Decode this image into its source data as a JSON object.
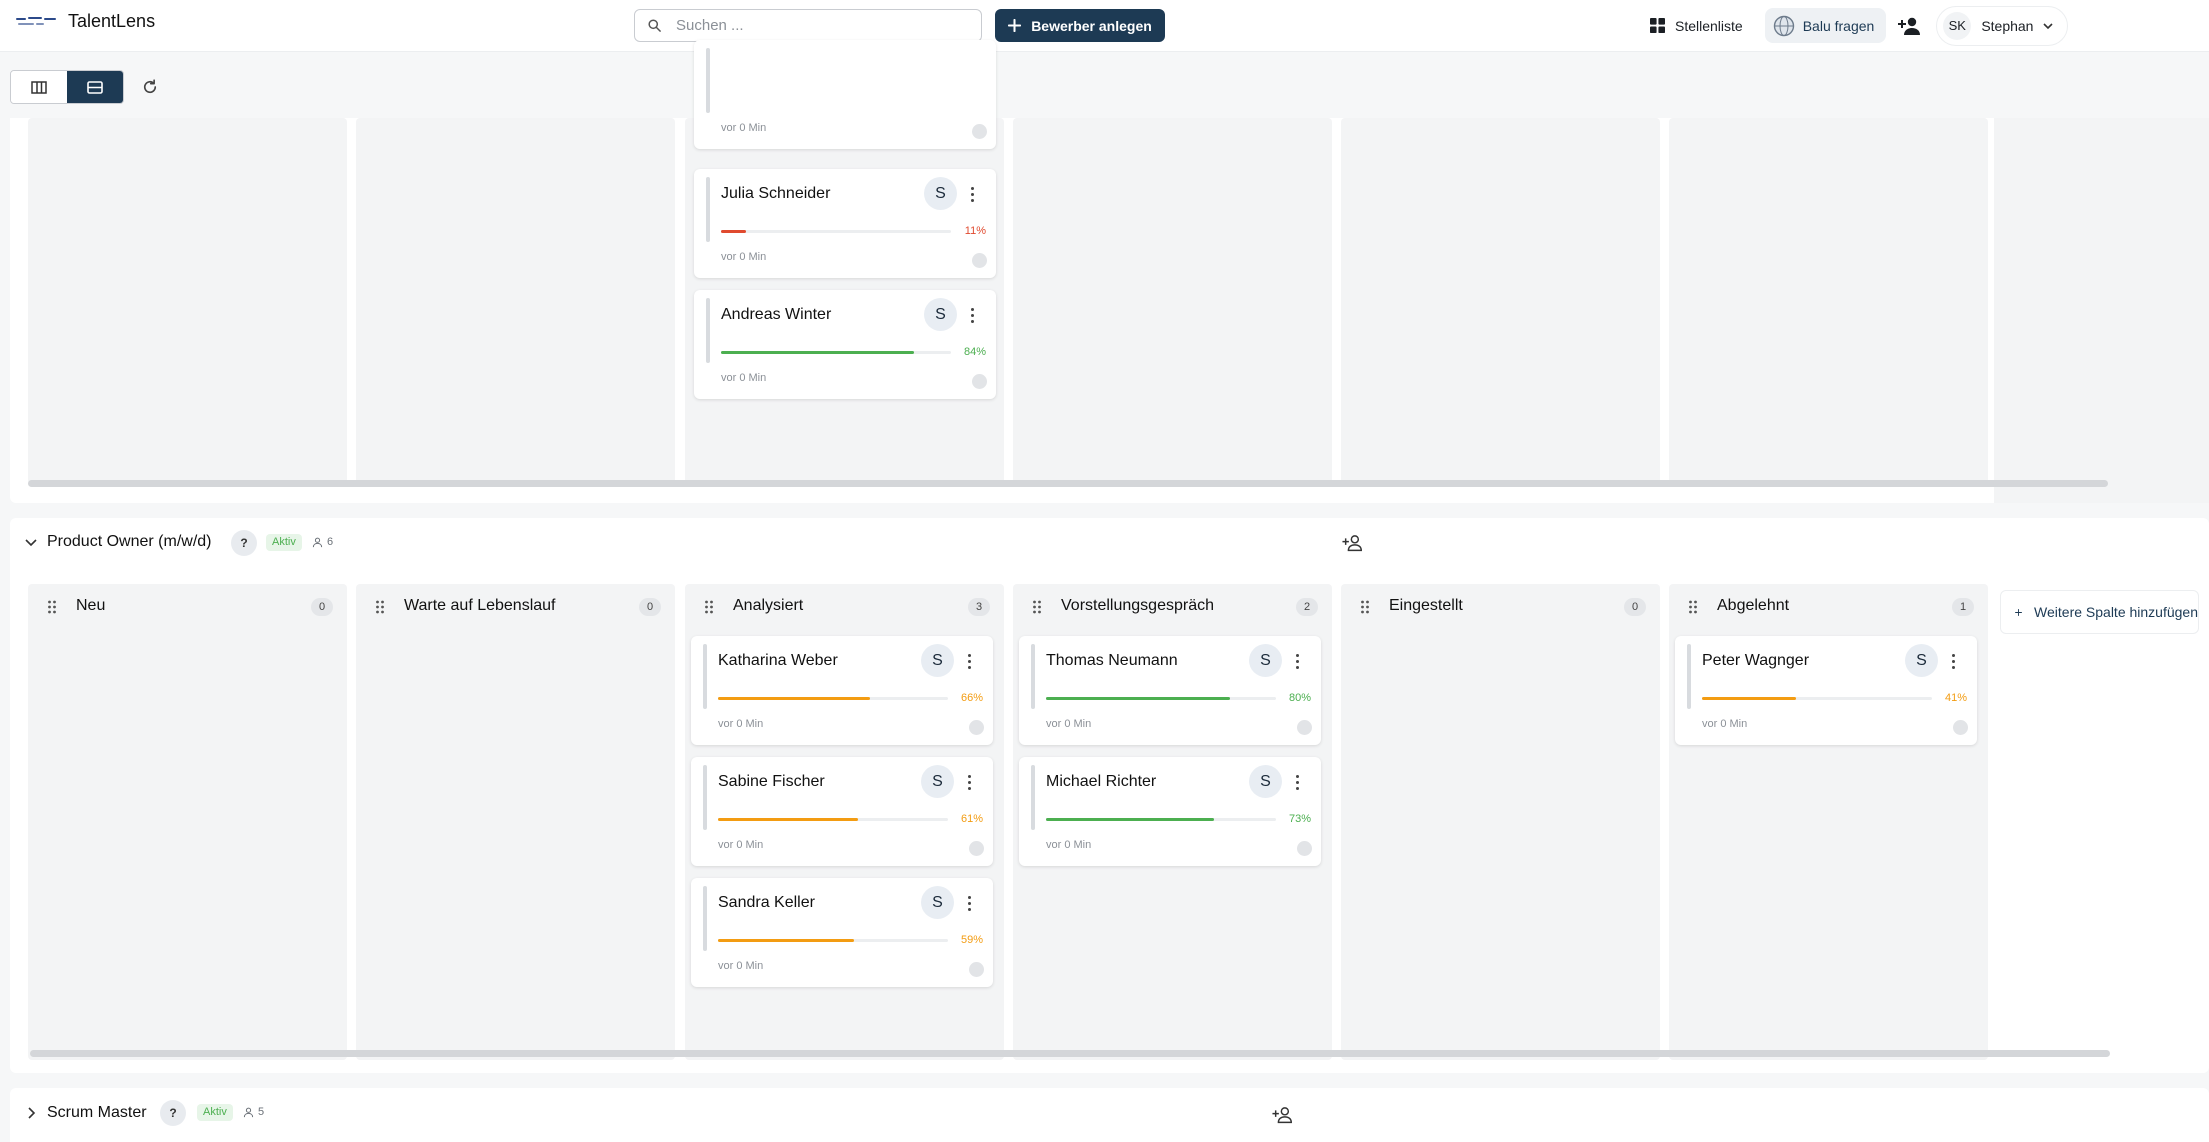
{
  "app": {
    "name": "TalentLens"
  },
  "search": {
    "placeholder": "Suchen ..."
  },
  "topbar": {
    "create_label": "Bewerber anlegen",
    "stellenliste_label": "Stellenliste",
    "balu_label": "Balu fragen",
    "user_initials": "SK",
    "user_name": "Stephan"
  },
  "boards": [
    {
      "id": "top",
      "columns": [
        {
          "cards": []
        },
        {
          "cards": []
        },
        {
          "cards": [
            {
              "name": "",
              "score": null,
              "time": "vor 0 Min"
            },
            {
              "name": "Julia Schneider",
              "badge": "S",
              "score": 11,
              "score_label": "11%",
              "time": "vor 0 Min",
              "color": "#e04a2f"
            },
            {
              "name": "Andreas Winter",
              "badge": "S",
              "score": 84,
              "score_label": "84%",
              "time": "vor 0 Min",
              "color": "#4caf50"
            }
          ]
        },
        {
          "cards": []
        },
        {
          "cards": []
        },
        {
          "cards": []
        }
      ]
    },
    {
      "id": "product-owner",
      "title": "Product Owner (m/w/d)",
      "q_badge": "?",
      "status": "Aktiv",
      "count": "6",
      "add_column_label": "Weitere Spalte hinzufügen",
      "columns": [
        {
          "title": "Neu",
          "count": "0",
          "cards": []
        },
        {
          "title": "Warte auf Lebenslauf",
          "count": "0",
          "cards": []
        },
        {
          "title": "Analysiert",
          "count": "3",
          "cards": [
            {
              "name": "Katharina Weber",
              "badge": "S",
              "score": 66,
              "score_label": "66%",
              "time": "vor 0 Min",
              "color": "#f39c12"
            },
            {
              "name": "Sabine Fischer",
              "badge": "S",
              "score": 61,
              "score_label": "61%",
              "time": "vor 0 Min",
              "color": "#f39c12"
            },
            {
              "name": "Sandra Keller",
              "badge": "S",
              "score": 59,
              "score_label": "59%",
              "time": "vor 0 Min",
              "color": "#f39c12"
            }
          ]
        },
        {
          "title": "Vorstellungsgespräch",
          "count": "2",
          "cards": [
            {
              "name": "Thomas Neumann",
              "badge": "S",
              "score": 80,
              "score_label": "80%",
              "time": "vor 0 Min",
              "color": "#4caf50"
            },
            {
              "name": "Michael Richter",
              "badge": "S",
              "score": 73,
              "score_label": "73%",
              "time": "vor 0 Min",
              "color": "#4caf50"
            }
          ]
        },
        {
          "title": "Eingestellt",
          "count": "0",
          "cards": []
        },
        {
          "title": "Abgelehnt",
          "count": "1",
          "cards": [
            {
              "name": "Peter Wagnger",
              "badge": "S",
              "score": 41,
              "score_label": "41%",
              "time": "vor 0 Min",
              "color": "#f39c12"
            }
          ]
        }
      ]
    },
    {
      "id": "scrum-master",
      "title": "Scrum Master",
      "q_badge": "?",
      "status": "Aktiv",
      "count": "5"
    }
  ],
  "colors": {
    "primary": "#1d3a54",
    "green": "#4caf50",
    "orange": "#f39c12",
    "red": "#e04a2f"
  },
  "icons": [
    "search-icon",
    "plus-icon",
    "grid-icon",
    "globe-icon",
    "add-user-icon",
    "chevron-down-icon",
    "columns-view-icon",
    "rows-view-icon",
    "refresh-icon",
    "drag-handle-icon",
    "more-vert-icon",
    "person-icon",
    "chevron-right-icon"
  ]
}
